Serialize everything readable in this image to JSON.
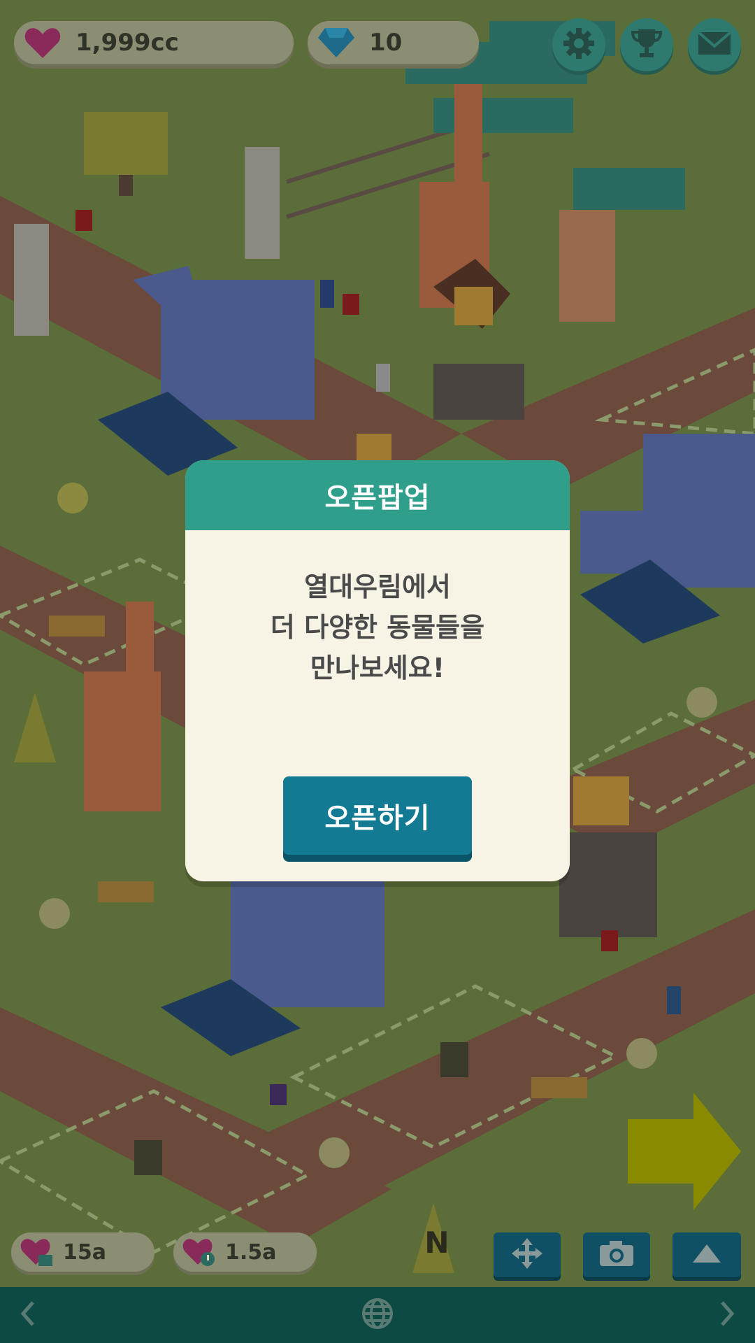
{
  "hud": {
    "hearts": "1,999cc",
    "gems": "10",
    "settings_icon": "gear-icon",
    "trophy_icon": "trophy-icon",
    "mail_icon": "mail-icon"
  },
  "popup": {
    "title": "오픈팝업",
    "lines": [
      "열대우림에서",
      "더 다양한 동물들을",
      "만나보세요!"
    ],
    "button_label": "오픈하기"
  },
  "bottom": {
    "rate_a": "15a",
    "rate_b": "1.5a",
    "move_icon": "move-arrows-icon",
    "camera_icon": "camera-icon",
    "up_icon": "triangle-up-icon",
    "compass": "N"
  },
  "nav": {
    "left_icon": "chevron-left-icon",
    "globe_icon": "globe-icon",
    "right_icon": "chevron-right-icon"
  },
  "colors": {
    "popup_header": "#2f9f8b",
    "popup_bg": "#f7f4e6",
    "button": "#127a92",
    "navbar": "#0e4a44",
    "arrow": "#8a8a00"
  }
}
